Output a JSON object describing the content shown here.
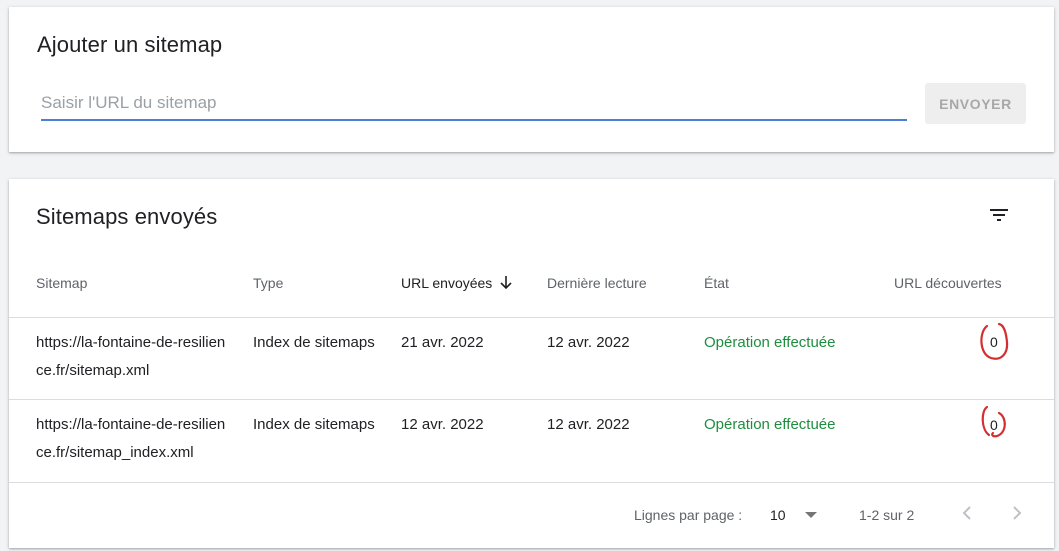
{
  "add_sitemap": {
    "title": "Ajouter un sitemap",
    "input_placeholder": "Saisir l'URL du sitemap",
    "input_value": "",
    "send_label": "ENVOYER"
  },
  "sent_sitemaps": {
    "title": "Sitemaps envoyés",
    "filter_icon": "filter-list-icon",
    "columns": {
      "sitemap": "Sitemap",
      "type": "Type",
      "submitted": "URL envoyées",
      "last_read": "Dernière lecture",
      "status": "État",
      "discovered": "URL découvertes"
    },
    "sort": {
      "column": "submitted",
      "direction": "desc",
      "icon": "arrow-downward-icon"
    },
    "rows": [
      {
        "sitemap": "https://la-fontaine-de-resilience.fr/sitemap.xml",
        "type": "Index de sitemaps",
        "submitted": "21 avr. 2022",
        "last_read": "12 avr. 2022",
        "status": "Opération effectuée",
        "discovered": "0"
      },
      {
        "sitemap": "https://la-fontaine-de-resilience.fr/sitemap_index.xml",
        "type": "Index de sitemaps",
        "submitted": "12 avr. 2022",
        "last_read": "12 avr. 2022",
        "status": "Opération effectuée",
        "discovered": "0"
      }
    ],
    "pagination": {
      "rows_per_page_label": "Lignes par page :",
      "rows_per_page_value": "10",
      "range": "1-2 sur 2"
    }
  },
  "colors": {
    "accent_input": "#4a7fd4",
    "status_success": "#1e8e3e",
    "annotation_red": "#d32f2f"
  }
}
